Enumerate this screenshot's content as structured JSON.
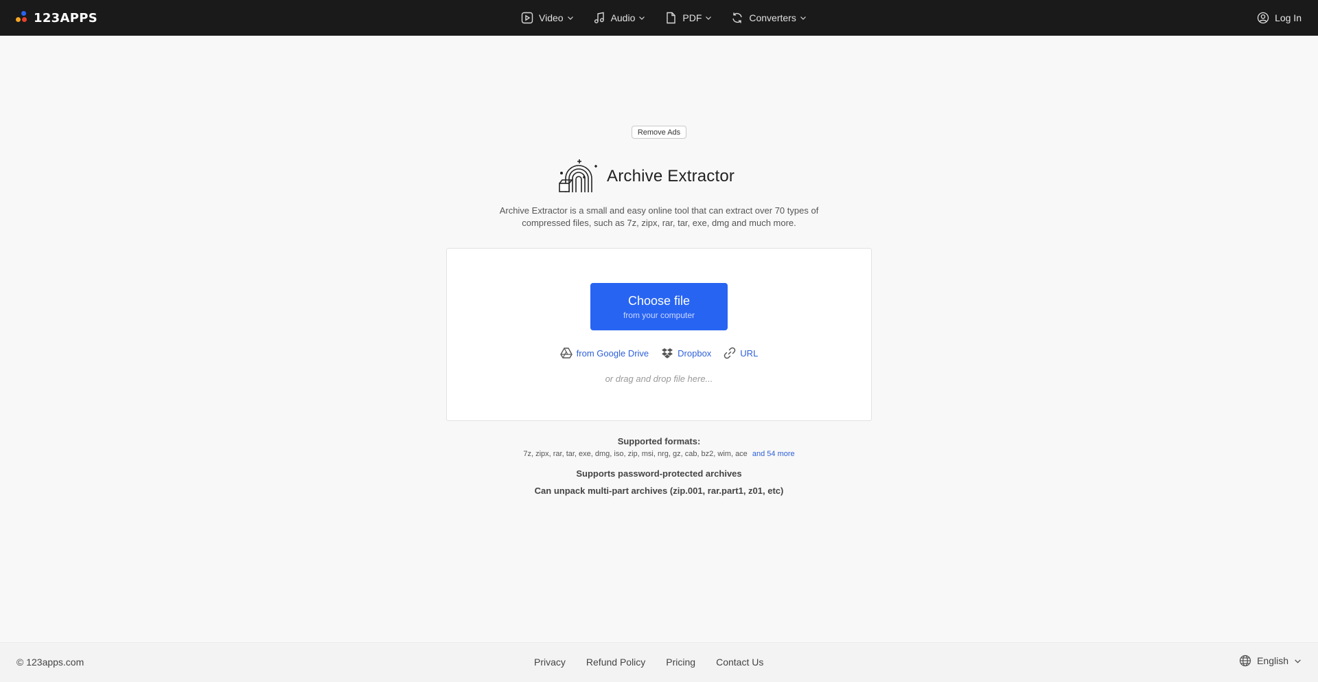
{
  "header": {
    "logo_text": "123APPS",
    "logo_colors": [
      "#2764f2",
      "#f5a623",
      "#e8412c",
      "#2bb673"
    ],
    "nav": [
      {
        "label": "Video",
        "icon": "play-icon"
      },
      {
        "label": "Audio",
        "icon": "music-note-icon"
      },
      {
        "label": "PDF",
        "icon": "file-icon"
      },
      {
        "label": "Converters",
        "icon": "refresh-icon"
      }
    ],
    "login_label": "Log In"
  },
  "main": {
    "remove_ads_label": "Remove Ads",
    "title": "Archive Extractor",
    "description": "Archive Extractor is a small and easy online tool that can extract over 70 types of compressed files, such as 7z, zipx, rar, tar, exe, dmg and much more.",
    "choose_button": {
      "label": "Choose file",
      "sublabel": "from your computer",
      "color": "#2764f2"
    },
    "sources": [
      {
        "label": "from Google Drive",
        "icon": "google-drive-icon"
      },
      {
        "label": "Dropbox",
        "icon": "dropbox-icon"
      },
      {
        "label": "URL",
        "icon": "link-icon"
      }
    ],
    "drag_hint": "or drag and drop file here...",
    "formats_label": "Supported formats:",
    "formats_list": "7z, zipx, rar, tar, exe, dmg, iso, zip, msi, nrg, gz, cab, bz2, wim, ace",
    "formats_more": "and 54 more",
    "feature_password": "Supports password-protected archives",
    "feature_multipart": "Can unpack multi-part archives (zip.001, rar.part1, z01, etc)"
  },
  "footer": {
    "copyright": "© 123apps.com",
    "links": [
      "Privacy",
      "Refund Policy",
      "Pricing",
      "Contact Us"
    ],
    "language": "English"
  }
}
